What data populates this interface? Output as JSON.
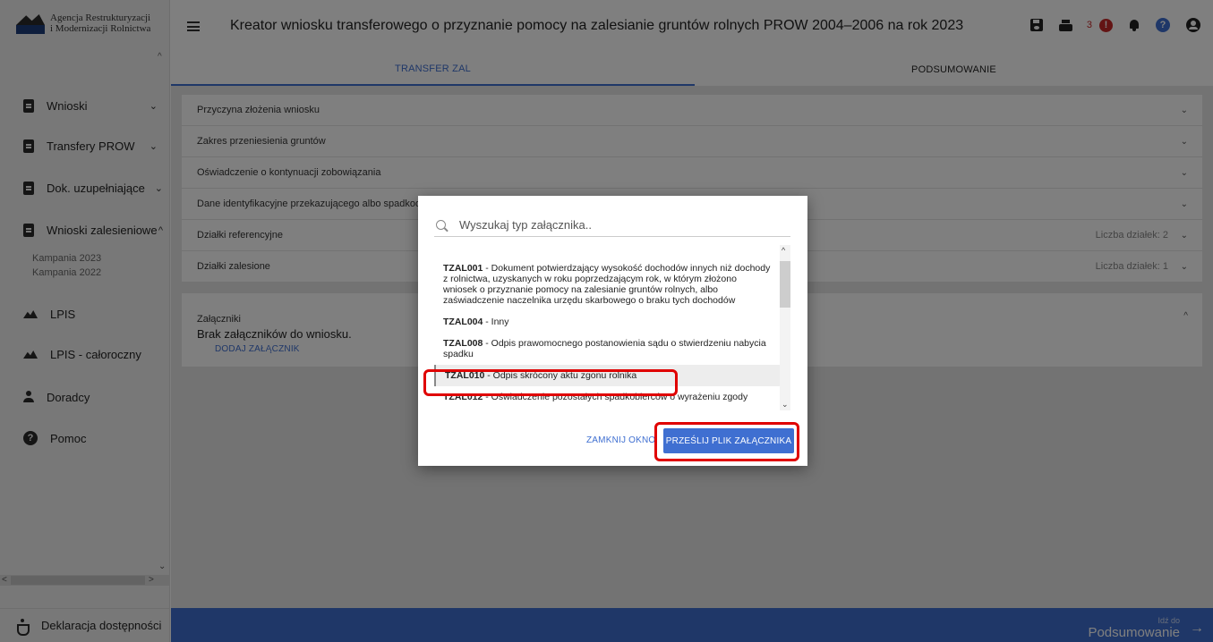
{
  "logo": {
    "line1": "Agencja Restrukturyzacji",
    "line2": "i Modernizacji Rolnictwa",
    "icon": "arimr-logo"
  },
  "sidebar": {
    "items": [
      {
        "label": "Wnioski",
        "icon": "document-icon",
        "chevron": "expand"
      },
      {
        "label": "Transfery PROW",
        "icon": "document-icon",
        "chevron": "expand"
      },
      {
        "label": "Dok. uzupełniające",
        "icon": "document-icon",
        "chevron": "expand"
      },
      {
        "label": "Wnioski zalesieniowe",
        "icon": "document-icon",
        "chevron": "collapse"
      },
      {
        "label": "LPIS",
        "icon": "mountain-icon"
      },
      {
        "label": "LPIS - całoroczny",
        "icon": "mountain-icon"
      },
      {
        "label": "Doradcy",
        "icon": "person-icon"
      },
      {
        "label": "Pomoc",
        "icon": "help-icon"
      }
    ],
    "subitems": [
      "Kampania 2023",
      "Kampania 2022"
    ],
    "footer": "Deklaracja dostępności"
  },
  "header": {
    "title": "Kreator wniosku transferowego o przyznanie pomocy na zalesianie gruntów rolnych PROW 2004–2006 na rok 2023",
    "alert_count": "3"
  },
  "tabs": [
    {
      "label": "TRANSFER ZAL",
      "active": true
    },
    {
      "label": "PODSUMOWANIE",
      "active": false
    }
  ],
  "sections": [
    {
      "label": "Przyczyna złożenia wniosku",
      "meta": ""
    },
    {
      "label": "Zakres przeniesienia gruntów",
      "meta": ""
    },
    {
      "label": "Oświadczenie o kontynuacji zobowiązania",
      "meta": ""
    },
    {
      "label": "Dane identyfikacyjne przekazującego albo spadkodawcy",
      "meta": ""
    },
    {
      "label": "Działki referencyjne",
      "meta": "Liczba działek: 2"
    },
    {
      "label": "Działki zalesione",
      "meta": "Liczba działek: 1"
    }
  ],
  "attachments": {
    "title": "Załączniki",
    "empty": "Brak załączników do wniosku.",
    "add_button": "DODAJ ZAŁĄCZNIK"
  },
  "footer": {
    "small": "Idź do",
    "next": "Podsumowanie"
  },
  "dialog": {
    "search_placeholder": "Wyszukaj typ załącznika..",
    "items": [
      {
        "code": "TZAL001",
        "text": " - Dokument potwierdzający wysokość dochodów innych niż dochody z rolnictwa, uzyskanych w roku poprzedzającym rok, w którym złożono wniosek o przyznanie pomocy na zalesianie gruntów rolnych, albo zaświadczenie naczelnika urzędu skarbowego o braku tych dochodów"
      },
      {
        "code": "TZAL004",
        "text": " - Inny"
      },
      {
        "code": "TZAL008",
        "text": " - Odpis prawomocnego postanowienia sądu o stwierdzeniu nabycia spadku"
      },
      {
        "code": "TZAL010",
        "text": " - Odpis skrócony aktu zgonu rolnika",
        "selected": true
      },
      {
        "code": "TZAL012",
        "text": " - Oświadczenie pozostałych spadkobierców o wyrażeniu zgody"
      }
    ],
    "close_label": "ZAMKNIJ OKNO",
    "upload_label": "PRZEŚLIJ PLIK ZAŁĄCZNIKA"
  },
  "colors": {
    "accent": "#3f6fd1",
    "alert": "#c62828",
    "highlight": "#e00000"
  }
}
